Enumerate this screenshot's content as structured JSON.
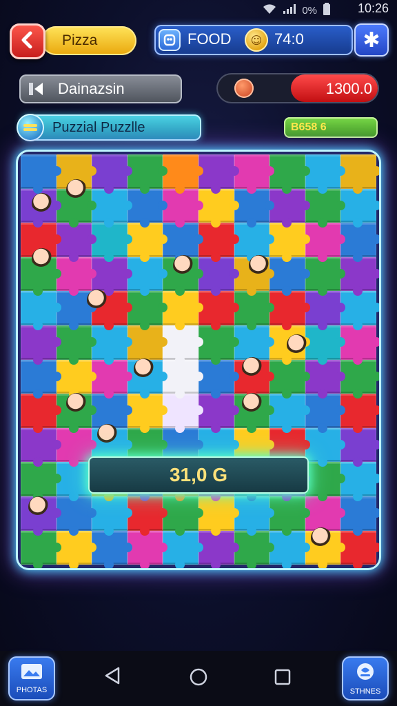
{
  "status_bar": {
    "battery": "0%",
    "time": "10:26"
  },
  "top_bar": {
    "title": "Pizza",
    "food_label": "FOOD",
    "coins": "74:0"
  },
  "mode": {
    "label": "Dainazsin"
  },
  "score": {
    "value": "1300.0"
  },
  "puzzle": {
    "label": "Puzzial Puzzlle"
  },
  "green_badge": {
    "text": "B658 6"
  },
  "board": {
    "rows": 12,
    "cols": 10,
    "tiles": [
      [
        "#2b7bd6",
        "#e8b21a",
        "#7a3fd0",
        "#2fa84a",
        "#ff8a1a",
        "#8b38c9",
        "#e23ab0",
        "#2fa84a",
        "#27b0e6",
        "#e8b21a"
      ],
      [
        "#7a3fd0",
        "#2fa84a",
        "#27b0e6",
        "#2b7bd6",
        "#e23ab0",
        "#ffcc1f",
        "#2b7bd6",
        "#8b38c9",
        "#2fa84a",
        "#27b0e6"
      ],
      [
        "#e8282e",
        "#8b38c9",
        "#1fb6c9",
        "#ffcc1f",
        "#2b7bd6",
        "#e8282e",
        "#27b0e6",
        "#ffcc1f",
        "#e23ab0",
        "#2b7bd6"
      ],
      [
        "#2fa84a",
        "#e23ab0",
        "#8b38c9",
        "#27b0e6",
        "#2fa84a",
        "#7a3fd0",
        "#e8b21a",
        "#2b7bd6",
        "#2fa84a",
        "#8b38c9"
      ],
      [
        "#27b0e6",
        "#2b7bd6",
        "#e8282e",
        "#2fa84a",
        "#ffcc1f",
        "#e8282e",
        "#2fa84a",
        "#e8282e",
        "#7a3fd0",
        "#27b0e6"
      ],
      [
        "#8b38c9",
        "#2fa84a",
        "#27b0e6",
        "#e8b21a",
        "#f2f2f8",
        "#2fa84a",
        "#27b0e6",
        "#ffcc1f",
        "#1fb6c9",
        "#e23ab0"
      ],
      [
        "#2b7bd6",
        "#ffcc1f",
        "#e23ab0",
        "#27b0e6",
        "#f2f2f8",
        "#2b7bd6",
        "#e8282e",
        "#2fa84a",
        "#8b38c9",
        "#2fa84a"
      ],
      [
        "#e8282e",
        "#2fa84a",
        "#2b7bd6",
        "#ffcc1f",
        "#efe4ff",
        "#8b38c9",
        "#2fa84a",
        "#27b0e6",
        "#2b7bd6",
        "#e8282e"
      ],
      [
        "#8b38c9",
        "#e23ab0",
        "#27b0e6",
        "#2fa84a",
        "#2b7bd6",
        "#27b0e6",
        "#ffcc1f",
        "#e8282e",
        "#27b0e6",
        "#7a3fd0"
      ],
      [
        "#2fa84a",
        "#27b0e6",
        "#e8b21a",
        "#8b38c9",
        "#ff8a1a",
        "#e23ab0",
        "#2b7bd6",
        "#8b38c9",
        "#2fa84a",
        "#27b0e6"
      ],
      [
        "#7a3fd0",
        "#2b7bd6",
        "#27b0e6",
        "#e8282e",
        "#2fa84a",
        "#ffcc1f",
        "#27b0e6",
        "#2fa84a",
        "#e23ab0",
        "#2b7bd6"
      ],
      [
        "#2fa84a",
        "#ffcc1f",
        "#2b7bd6",
        "#e23ab0",
        "#27b0e6",
        "#8b38c9",
        "#2fa84a",
        "#27b0e6",
        "#ffcc1f",
        "#e8282e"
      ]
    ]
  },
  "result": {
    "text": "31,0 G"
  },
  "bottom": {
    "left_label": "PHOTAS",
    "right_label": "STHNES"
  },
  "colors": {
    "accent_cyan": "#43d6ff",
    "score_red": "#d8181c",
    "gold": "#e9a70c"
  },
  "icons": [
    "back-arrow-icon",
    "food-icon",
    "coin-icon",
    "settings-icon",
    "mode-icon",
    "puzzle-icon",
    "photos-icon",
    "stickers-icon"
  ]
}
